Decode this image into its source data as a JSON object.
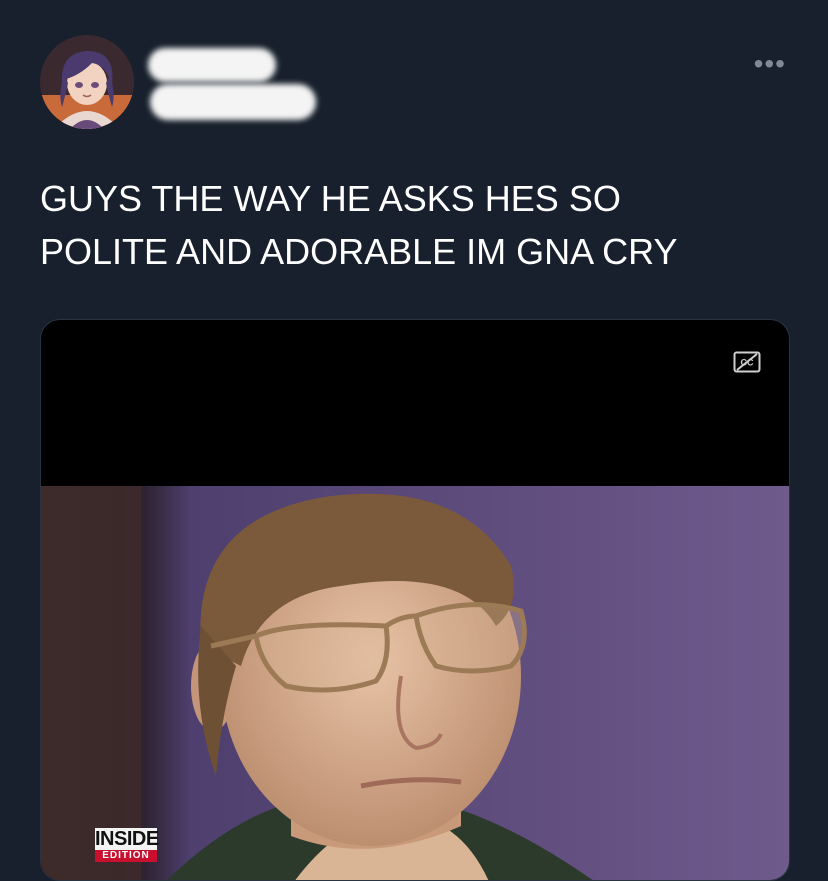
{
  "tweet": {
    "text_line1": "GUYS THE WAY HE ASKS HES SO",
    "text_line2": "POLITE AND ADORABLE IM GNA CRY",
    "more_icon": "more-options-icon",
    "more_glyph": "•••"
  },
  "media": {
    "cc_icon": "closed-captions-icon",
    "watermark_top": "INSIDE",
    "watermark_bottom": "EDITION"
  },
  "colors": {
    "background": "#17202c",
    "text": "#ffffff",
    "muted": "#7f8a96"
  }
}
